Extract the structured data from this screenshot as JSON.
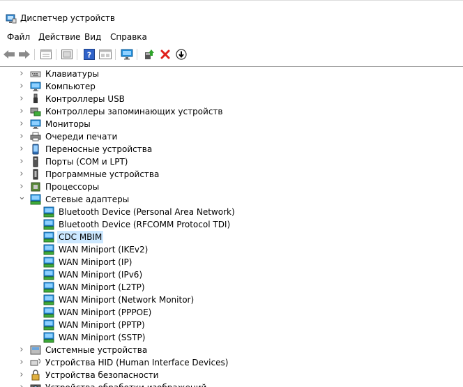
{
  "window": {
    "title": "Диспетчер устройств"
  },
  "menu": [
    "Файл",
    "Действие",
    "Вид",
    "Справка"
  ],
  "toolbar": {
    "buttons": [
      "back-icon",
      "forward-icon",
      "properties-icon",
      "show-hidden-icon",
      "help-icon",
      "scan-icon",
      "monitor-icon",
      "update-driver-icon",
      "uninstall-icon",
      "disable-icon"
    ]
  },
  "tree": {
    "top_categories": [
      {
        "label": "Клавиатуры",
        "icon": "keyboard-icon"
      },
      {
        "label": "Компьютер",
        "icon": "computer-icon"
      },
      {
        "label": "Контроллеры USB",
        "icon": "usb-icon"
      },
      {
        "label": "Контроллеры запоминающих устройств",
        "icon": "storage-controller-icon"
      },
      {
        "label": "Мониторы",
        "icon": "monitor-icon"
      },
      {
        "label": "Очереди печати",
        "icon": "printer-icon"
      },
      {
        "label": "Переносные устройства",
        "icon": "portable-device-icon"
      },
      {
        "label": "Порты (COM и LPT)",
        "icon": "port-icon"
      },
      {
        "label": "Программные устройства",
        "icon": "software-device-icon"
      },
      {
        "label": "Процессоры",
        "icon": "processor-icon"
      }
    ],
    "network": {
      "label": "Сетевые адаптеры",
      "icon": "network-adapter-icon",
      "children": [
        "Bluetooth Device (Personal Area Network)",
        "Bluetooth Device (RFCOMM Protocol TDI)",
        "CDC MBIM",
        "WAN Miniport (IKEv2)",
        "WAN Miniport (IP)",
        "WAN Miniport (IPv6)",
        "WAN Miniport (L2TP)",
        "WAN Miniport (Network Monitor)",
        "WAN Miniport (PPPOE)",
        "WAN Miniport (PPTP)",
        "WAN Miniport (SSTP)"
      ],
      "selected": "CDC MBIM"
    },
    "bottom_categories": [
      {
        "label": "Системные устройства",
        "icon": "system-device-icon"
      },
      {
        "label": "Устройства HID (Human Interface Devices)",
        "icon": "hid-icon"
      },
      {
        "label": "Устройства безопасности",
        "icon": "security-device-icon"
      },
      {
        "label": "Устройства обработки изображений",
        "icon": "imaging-device-icon"
      }
    ]
  },
  "colors": {
    "selection": "#cce8ff",
    "network_green": "#3fae3a",
    "screen_blue": "#1f8fdc"
  }
}
